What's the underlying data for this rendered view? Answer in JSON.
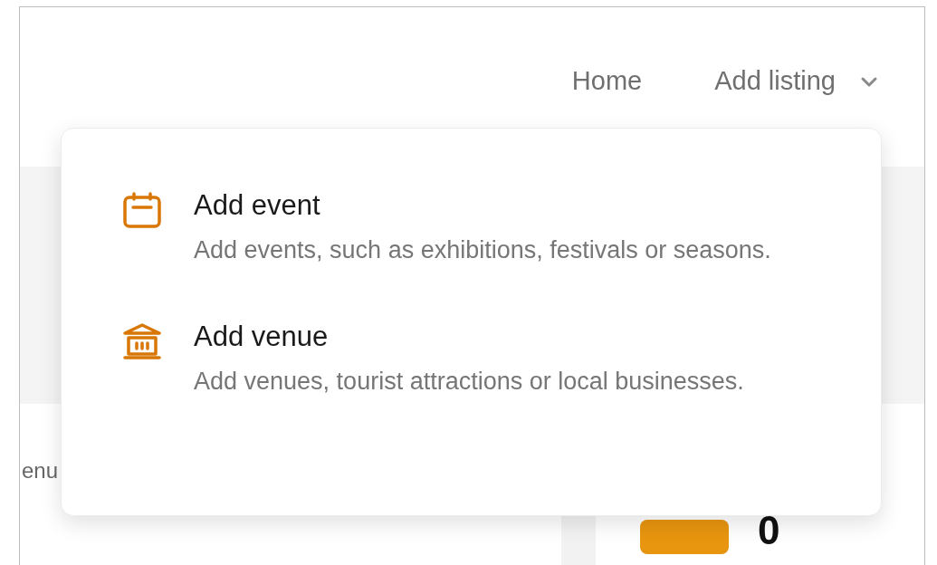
{
  "nav": {
    "items": [
      {
        "label": "Home",
        "kind": "link"
      },
      {
        "label": "Add listing",
        "kind": "dropdown",
        "expanded": true
      }
    ]
  },
  "dropdown_menu": {
    "items": [
      {
        "title": "Add event",
        "description": "Add events, such as exhibitions, festivals or seasons.",
        "kind": "event"
      },
      {
        "title": "Add venue",
        "description": "Add venues, tourist attractions or local businesses.",
        "kind": "venue"
      }
    ]
  },
  "background": {
    "left_card_text": "enu",
    "right_card_value": "0"
  }
}
